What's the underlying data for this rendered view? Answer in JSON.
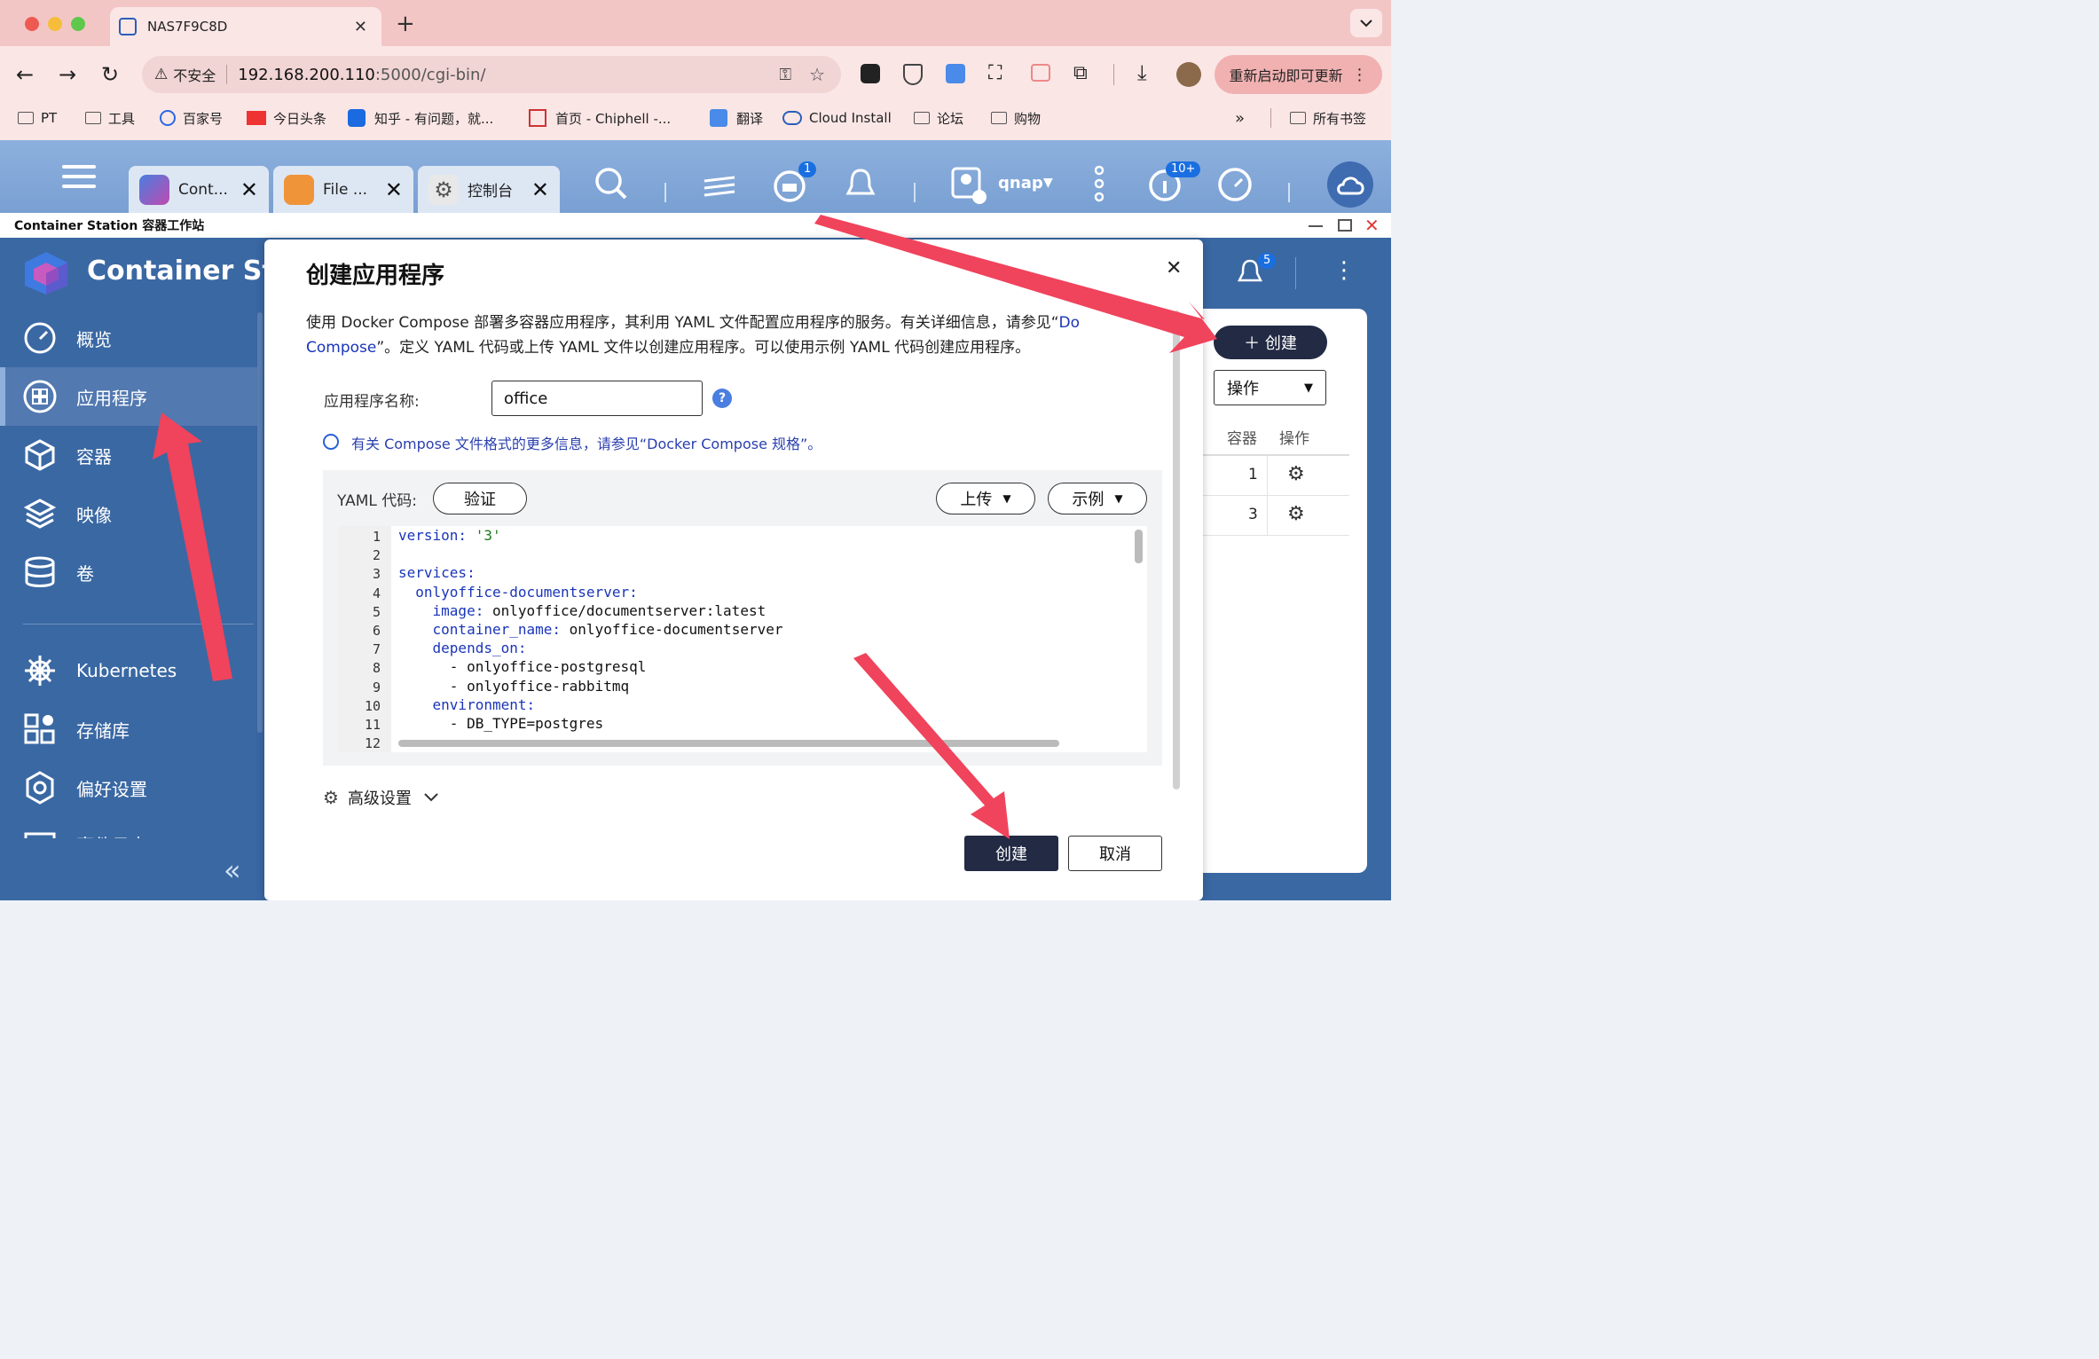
{
  "browser": {
    "tab_title": "NAS7F9C8D",
    "address_security": "不安全",
    "address_url_host": "192.168.200.110",
    "address_url_path": ":5000/cgi-bin/",
    "update_button": "重新启动即可更新",
    "bookmarks": [
      "PT",
      "工具",
      "百家号",
      "今日头条",
      "知乎 - 有问题，就...",
      "首页 - Chiphell -...",
      "翻译",
      "Cloud Install",
      "论坛",
      "购物"
    ],
    "bookmarks_more": "»",
    "all_bookmarks": "所有书签"
  },
  "qts": {
    "tabs": [
      {
        "label": "Cont...",
        "close": "✕"
      },
      {
        "label": "File ...",
        "close": "✕"
      },
      {
        "label": "控制台",
        "close": "✕"
      }
    ],
    "sync_badge": "1",
    "user": "qnap",
    "update_badge": "10+"
  },
  "window": {
    "title": "Container Station 容器工作站"
  },
  "sidebar": {
    "app_name": "Container Stat",
    "items": [
      {
        "label": "概览",
        "icon": "dashboard-icon"
      },
      {
        "label": "应用程序",
        "icon": "apps-grid-icon"
      },
      {
        "label": "容器",
        "icon": "cube-icon"
      },
      {
        "label": "映像",
        "icon": "layers-icon"
      },
      {
        "label": "卷",
        "icon": "database-icon"
      },
      {
        "label": "Kubernetes",
        "icon": "helm-icon"
      },
      {
        "label": "存储库",
        "icon": "repository-icon"
      },
      {
        "label": "偏好设置",
        "icon": "settings-icon"
      },
      {
        "label": "事件日志",
        "icon": "log-icon"
      }
    ],
    "collapse": "«"
  },
  "right_panel": {
    "notif_badge": "5",
    "create_button": "＋  创建",
    "actions_select": "操作",
    "col_containers": "容器",
    "col_actions": "操作",
    "rows": [
      {
        "containers": "1"
      },
      {
        "containers": "3"
      }
    ]
  },
  "dialog": {
    "title": "创建应用程序",
    "close": "✕",
    "desc_line1_a": "使用 Docker Compose 部署多容器应用程序，其利用 YAML 文件配置应用程序的服务。有关详细信息，请参见“",
    "desc_line1_link": "Do",
    "desc_line2_link": "Compose",
    "desc_line2_b": "”。定义 YAML 代码或上传 YAML 文件以创建应用程序。可以使用示例 YAML 代码创建应用程序。",
    "name_label": "应用程序名称:",
    "name_value": "office",
    "help": "?",
    "info_text": "有关 Compose 文件格式的更多信息，请参见“",
    "info_link": "Docker Compose 规格",
    "info_end": "”。",
    "yaml_label": "YAML 代码:",
    "validate_button": "验证",
    "upload_button": "上传",
    "example_button": "示例",
    "advanced": "高级设置",
    "create_button": "创建",
    "cancel_button": "取消",
    "code": [
      {
        "n": "1",
        "key": "version:",
        "val": " '3'"
      },
      {
        "n": "2",
        "key": "",
        "val": ""
      },
      {
        "n": "3",
        "key": "services:",
        "val": ""
      },
      {
        "n": "4",
        "key": "  onlyoffice-documentserver:",
        "val": ""
      },
      {
        "n": "5",
        "key": "    image:",
        "val": " onlyoffice/documentserver:latest"
      },
      {
        "n": "6",
        "key": "    container_name:",
        "val": " onlyoffice-documentserver"
      },
      {
        "n": "7",
        "key": "    depends_on:",
        "val": ""
      },
      {
        "n": "8",
        "key": "",
        "val": "      - onlyoffice-postgresql"
      },
      {
        "n": "9",
        "key": "",
        "val": "      - onlyoffice-rabbitmq"
      },
      {
        "n": "10",
        "key": "    environment:",
        "val": ""
      },
      {
        "n": "11",
        "key": "",
        "val": "      - DB_TYPE=postgres"
      },
      {
        "n": "12",
        "key": "",
        "val": ""
      }
    ]
  },
  "colors": {
    "sidebar": "#3a68a3",
    "accent_dark": "#222a44",
    "annotation_arrow": "#f0435c",
    "link": "#1a35b8"
  }
}
